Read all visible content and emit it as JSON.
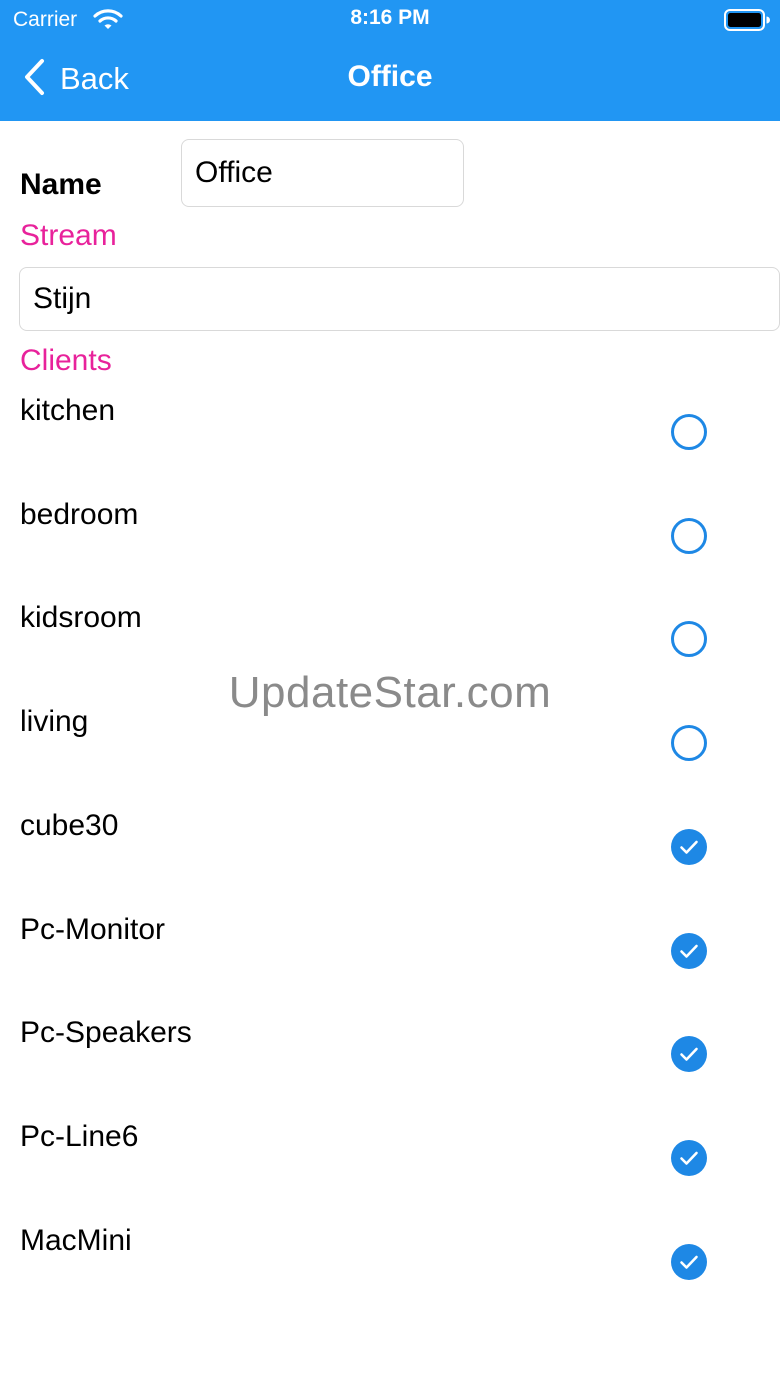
{
  "status_bar": {
    "carrier": "Carrier",
    "time": "8:16 PM",
    "icons": [
      "wifi-icon",
      "battery-icon"
    ]
  },
  "nav": {
    "back_label": "Back",
    "title": "Office",
    "icon": "chevron-left-icon"
  },
  "form": {
    "name_label": "Name",
    "name_value": "Office",
    "stream_label": "Stream",
    "stream_value": "Stijn",
    "clients_label": "Clients"
  },
  "clients": [
    {
      "name": "kitchen",
      "checked": false
    },
    {
      "name": "bedroom",
      "checked": false
    },
    {
      "name": "kidsroom",
      "checked": false
    },
    {
      "name": "living",
      "checked": false
    },
    {
      "name": "cube30",
      "checked": true
    },
    {
      "name": "Pc-Monitor",
      "checked": true
    },
    {
      "name": "Pc-Speakers",
      "checked": true
    },
    {
      "name": "Pc-Line6",
      "checked": true
    },
    {
      "name": "MacMini",
      "checked": true
    }
  ],
  "watermark": "UpdateStar.com",
  "colors": {
    "header": "#2196F3",
    "section_label": "#E8229B",
    "checkbox": "#1E88E5"
  }
}
